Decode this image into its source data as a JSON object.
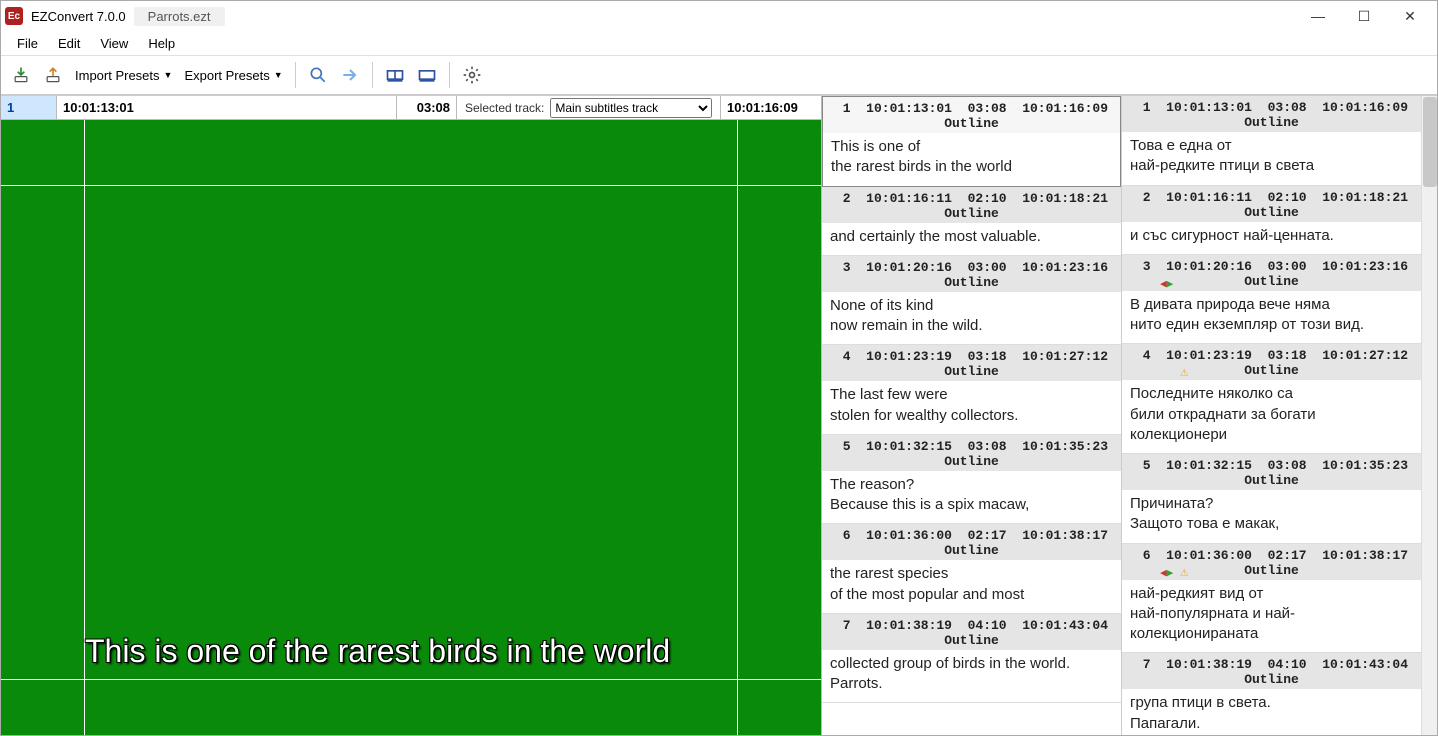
{
  "titlebar": {
    "logo_text": "Ec",
    "app_title": "EZConvert 7.0.0",
    "doc_name": "Parrots.ezt"
  },
  "menu": [
    "File",
    "Edit",
    "View",
    "Help"
  ],
  "toolbar": {
    "import_presets": "Import Presets",
    "export_presets": "Export Presets"
  },
  "timebar": {
    "index": "1",
    "tc_in": "10:01:13:01",
    "duration": "03:08",
    "track_label": "Selected track:",
    "track_value": "Main subtitles track",
    "tc_out": "10:01:16:09"
  },
  "preview_text": "This is one of\nthe rarest birds in the world",
  "subtitles_left": [
    {
      "n": "1",
      "in": "10:01:13:01",
      "dur": "03:08",
      "out": "10:01:16:09",
      "style": "Outline",
      "text": "This is one of\nthe rarest birds in the world",
      "sel": true
    },
    {
      "n": "2",
      "in": "10:01:16:11",
      "dur": "02:10",
      "out": "10:01:18:21",
      "style": "Outline",
      "text": "and certainly the most valuable."
    },
    {
      "n": "3",
      "in": "10:01:20:16",
      "dur": "03:00",
      "out": "10:01:23:16",
      "style": "Outline",
      "text": "None of its kind\nnow remain in the wild."
    },
    {
      "n": "4",
      "in": "10:01:23:19",
      "dur": "03:18",
      "out": "10:01:27:12",
      "style": "Outline",
      "text": "The last few were\nstolen for wealthy collectors."
    },
    {
      "n": "5",
      "in": "10:01:32:15",
      "dur": "03:08",
      "out": "10:01:35:23",
      "style": "Outline",
      "text": "The reason?\nBecause this is a spix macaw,"
    },
    {
      "n": "6",
      "in": "10:01:36:00",
      "dur": "02:17",
      "out": "10:01:38:17",
      "style": "Outline",
      "text": "the rarest species\nof the most popular and most"
    },
    {
      "n": "7",
      "in": "10:01:38:19",
      "dur": "04:10",
      "out": "10:01:43:04",
      "style": "Outline",
      "text": "collected group of birds in the world.\nParrots."
    }
  ],
  "subtitles_right": [
    {
      "n": "1",
      "in": "10:01:13:01",
      "dur": "03:08",
      "out": "10:01:16:09",
      "style": "Outline",
      "text": "Това е една от\nнай-редките птици в света"
    },
    {
      "n": "2",
      "in": "10:01:16:11",
      "dur": "02:10",
      "out": "10:01:18:21",
      "style": "Outline",
      "text": "и със сигурност най-ценната."
    },
    {
      "n": "3",
      "in": "10:01:20:16",
      "dur": "03:00",
      "out": "10:01:23:16",
      "style": "Outline",
      "text": "В дивата природа вече няма\nнито един екземпляр от този вид.",
      "marker": true
    },
    {
      "n": "4",
      "in": "10:01:23:19",
      "dur": "03:18",
      "out": "10:01:27:12",
      "style": "Outline",
      "text": "Последните няколко са\nбили откраднати за богати колекционери",
      "warn": true
    },
    {
      "n": "5",
      "in": "10:01:32:15",
      "dur": "03:08",
      "out": "10:01:35:23",
      "style": "Outline",
      "text": "Причината?\nЗащото това е макак,"
    },
    {
      "n": "6",
      "in": "10:01:36:00",
      "dur": "02:17",
      "out": "10:01:38:17",
      "style": "Outline",
      "text": "най-редкият вид от\nнай-популярната и най-колекционираната",
      "marker": true,
      "warn": true
    },
    {
      "n": "7",
      "in": "10:01:38:19",
      "dur": "04:10",
      "out": "10:01:43:04",
      "style": "Outline",
      "text": "група птици в света.\nПапагали."
    }
  ]
}
